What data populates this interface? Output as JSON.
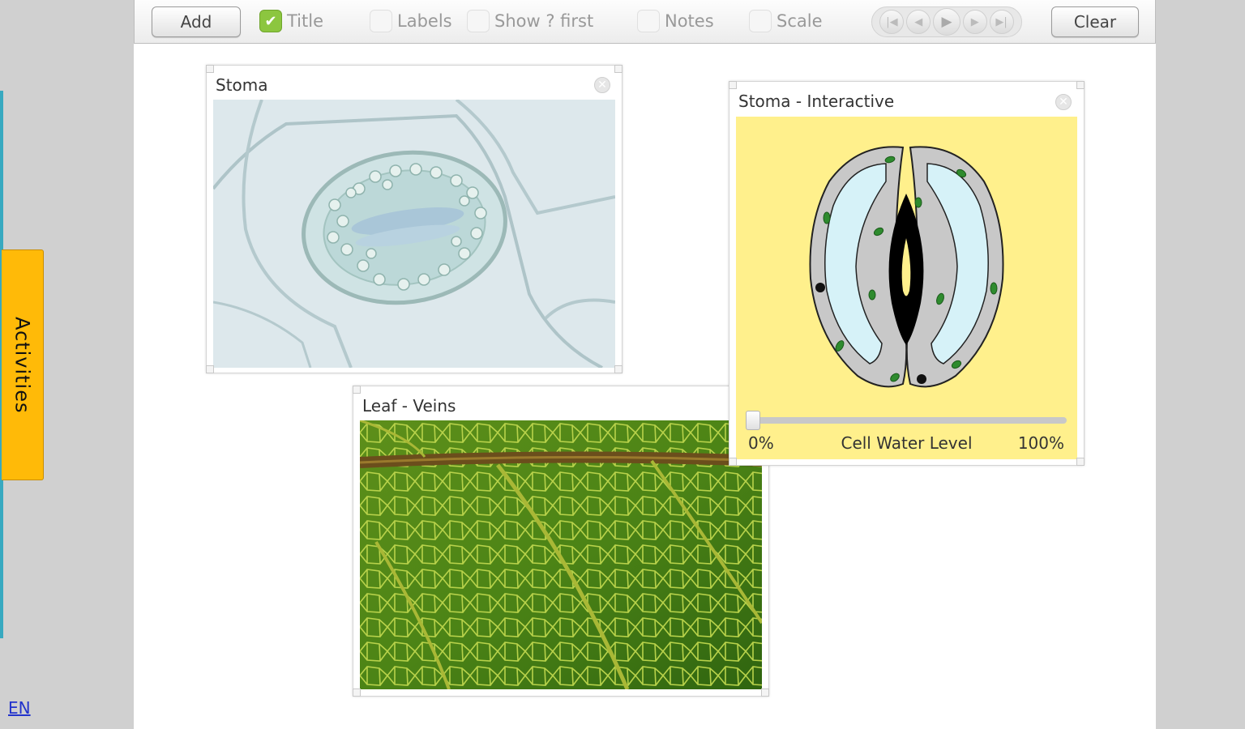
{
  "toolbar": {
    "add_label": "Add",
    "clear_label": "Clear",
    "checks": [
      {
        "label": "Title",
        "checked": true
      },
      {
        "label": "Labels",
        "checked": false
      },
      {
        "label": "Show ? first",
        "checked": false
      },
      {
        "label": "Notes",
        "checked": false
      },
      {
        "label": "Scale",
        "checked": false
      }
    ],
    "player": [
      "first-icon",
      "prev-icon",
      "play-icon",
      "next-icon",
      "last-icon"
    ]
  },
  "sidebar": {
    "activities_label": "Activities",
    "language": "EN"
  },
  "panels": {
    "stoma_photo": {
      "title": "Stoma"
    },
    "leaf_veins": {
      "title": "Leaf - Veins"
    },
    "stoma_interactive": {
      "title": "Stoma - Interactive",
      "slider": {
        "min_label": "0%",
        "label": "Cell Water Level",
        "max_label": "100%",
        "value_percent": 0
      }
    }
  },
  "colors": {
    "accent_tab": "#ffba08",
    "rail": "#38a9c0",
    "interactive_bg": "#fff08c",
    "guard_cell": "#c8c8c8",
    "vacuole": "#d6f2f8",
    "chloroplast": "#2e8b2e"
  }
}
